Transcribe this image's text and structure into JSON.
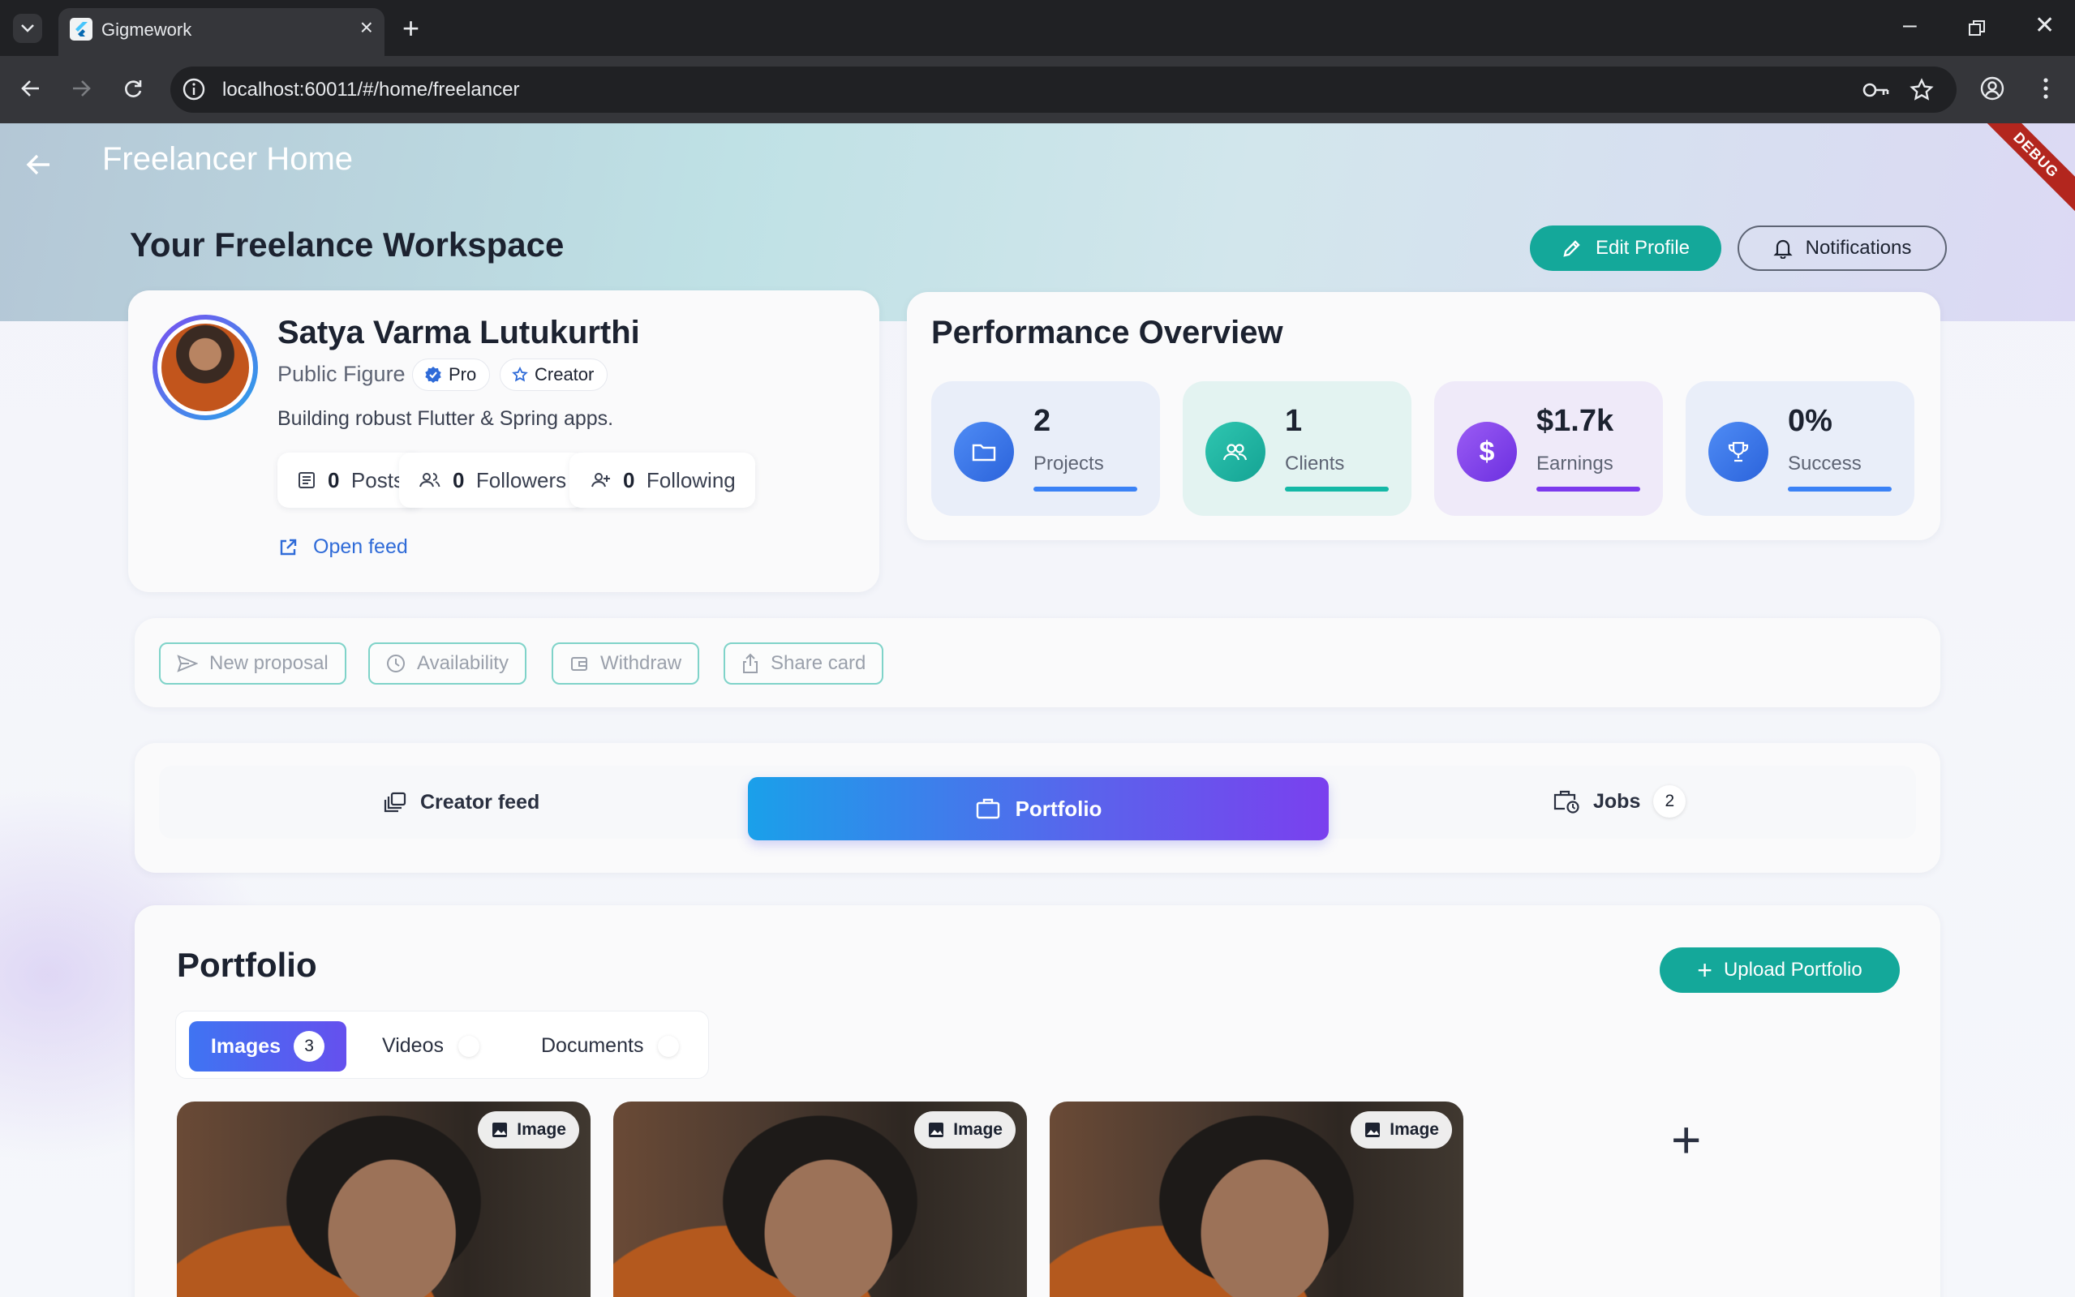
{
  "browser": {
    "tab_title": "Gigmework",
    "url": "localhost:60011/#/home/freelancer"
  },
  "app": {
    "debug_banner": "DEBUG",
    "appbar_title": "Freelancer Home",
    "workspace_title": "Your Freelance Workspace",
    "edit_profile_label": "Edit Profile",
    "notifications_label": "Notifications"
  },
  "profile": {
    "name": "Satya Varma Lutukurthi",
    "role": "Public Figure",
    "badges": [
      "Pro",
      "Creator"
    ],
    "bio": "Building robust Flutter & Spring apps.",
    "stats": [
      {
        "value": "0",
        "label": "Posts"
      },
      {
        "value": "0",
        "label": "Followers"
      },
      {
        "value": "0",
        "label": "Following"
      }
    ],
    "open_feed_label": "Open feed"
  },
  "performance": {
    "title": "Performance Overview",
    "metrics": [
      {
        "value": "2",
        "label": "Projects",
        "icon": "folder-icon",
        "color": "#3b82f6"
      },
      {
        "value": "1",
        "label": "Clients",
        "icon": "people-icon",
        "color": "#14b8a6"
      },
      {
        "value": "$1.7k",
        "label": "Earnings",
        "icon": "dollar-icon",
        "color": "#7c3aed"
      },
      {
        "value": "0%",
        "label": "Success",
        "icon": "trophy-icon",
        "color": "#3b82f6"
      }
    ]
  },
  "quick_actions": [
    "New proposal",
    "Availability",
    "Withdraw",
    "Share card"
  ],
  "main_tabs": {
    "creator_feed": "Creator feed",
    "portfolio": "Portfolio",
    "jobs": "Jobs",
    "jobs_count": "2"
  },
  "portfolio": {
    "title": "Portfolio",
    "upload_label": "Upload Portfolio",
    "segments": {
      "images": "Images",
      "images_count": "3",
      "videos": "Videos",
      "documents": "Documents"
    },
    "items": [
      {
        "badge": "Image"
      },
      {
        "badge": "Image"
      },
      {
        "badge": "Image"
      }
    ]
  }
}
